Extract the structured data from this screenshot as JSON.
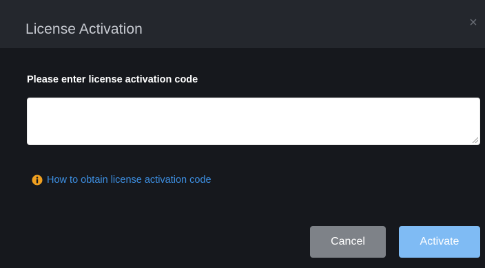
{
  "dialog": {
    "title": "License Activation",
    "close_glyph": "×",
    "field_label": "Please enter license activation code",
    "input_value": "",
    "input_placeholder": "",
    "help_link_text": "How to obtain license activation code",
    "help_icon": "info-circle-icon",
    "buttons": {
      "cancel_label": "Cancel",
      "activate_label": "Activate"
    }
  },
  "colors": {
    "dialog_bg": "#16181d",
    "header_bg": "#24272d",
    "link": "#3d8fe2",
    "info_icon": "#f0a020",
    "cancel_bg": "#7e8288",
    "activate_bg": "#7fbbf4"
  }
}
